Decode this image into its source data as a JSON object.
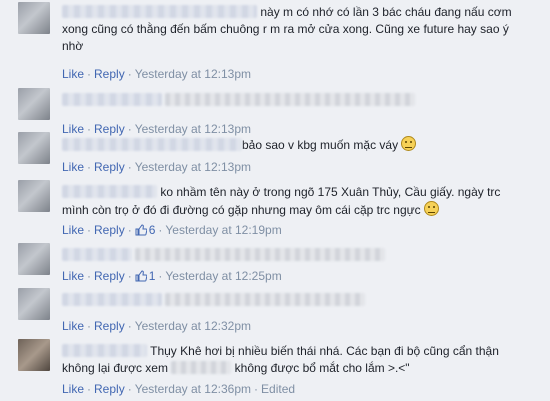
{
  "action_like": "Like",
  "action_reply": "Reply",
  "separator": "·",
  "colors": {
    "link": "#4267b2",
    "meta": "#7f8fa4",
    "background": "#eef0f4"
  },
  "comments": [
    {
      "text": "này m có nhớ có lần 3 bác cháu đang nấu cơm xong cũng có thằng đến bấm chuông r m ra mở cửa xong. Cũng xe future hay sao ý nhờ",
      "time": "Yesterday at 12:13pm"
    },
    {
      "text": "",
      "time": "Yesterday at 12:13pm"
    },
    {
      "text": "bảo sao v kbg muốn mặc váy",
      "emoji": "confused-face-emoji",
      "time": "Yesterday at 12:13pm"
    },
    {
      "text": "ko nhầm tên này ở trong ngõ 175 Xuân Thủy, Cầu giấy. ngày trc mình còn trọ ở đó đi đường có gặp nhưng may ôm cái cặp trc ngực",
      "emoji": "grimace-face-emoji",
      "likes": "6",
      "time": "Yesterday at 12:19pm"
    },
    {
      "text": "",
      "likes": "1",
      "time": "Yesterday at 12:25pm"
    },
    {
      "text": "",
      "time": "Yesterday at 12:32pm"
    },
    {
      "text_a": "Thụy Khê hơi bị nhiều biến thái nhá. Các bạn đi bộ cũng cẩn thận không lại được xem",
      "text_b": "không được bổ mắt cho lắm >.<\"",
      "time": "Yesterday at 12:36pm",
      "edited": "Edited"
    }
  ]
}
